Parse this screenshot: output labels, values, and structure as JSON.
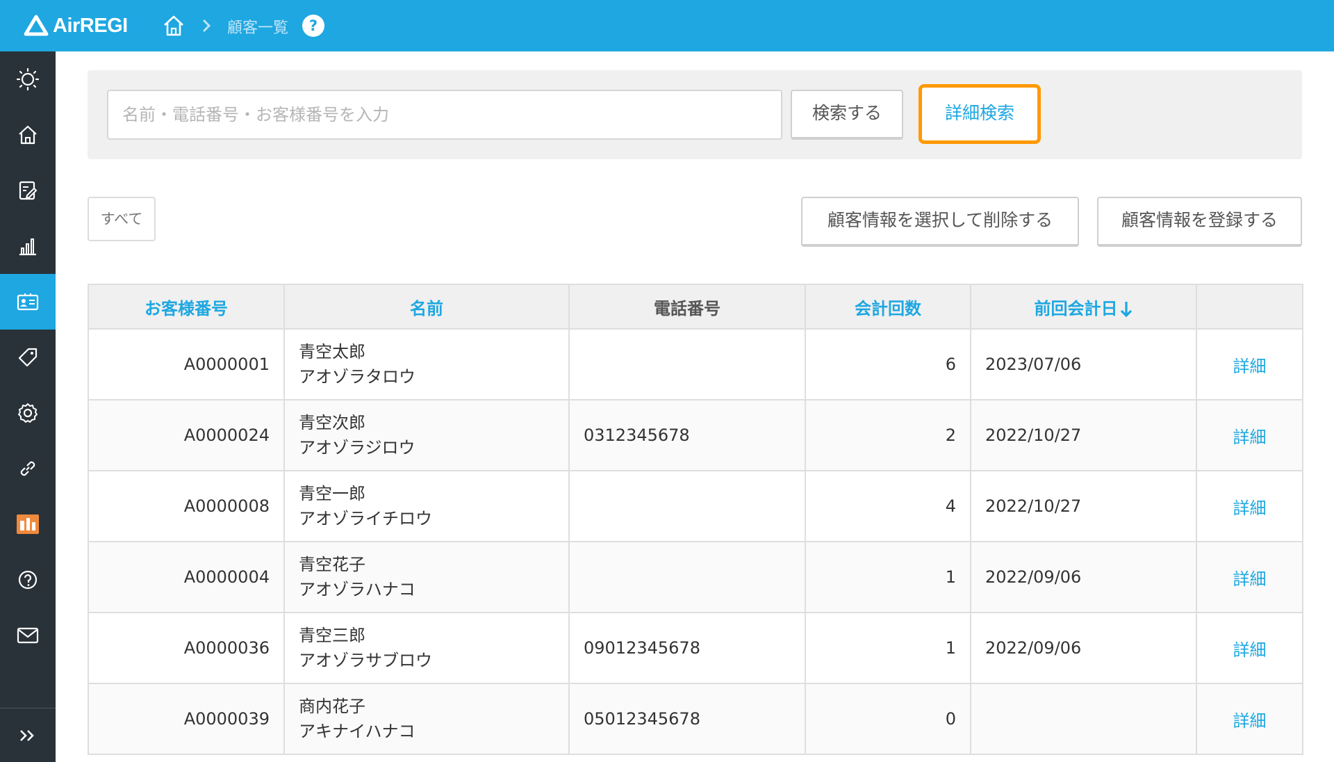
{
  "header": {
    "logo_text": "AirREGI",
    "page_title": "顧客一覧",
    "help_mark": "?"
  },
  "sidebar": {
    "items": [
      {
        "icon": "sun-icon"
      },
      {
        "icon": "home-icon"
      },
      {
        "icon": "edit-note-icon"
      },
      {
        "icon": "bar-chart-icon"
      },
      {
        "icon": "customer-card-icon",
        "active": true
      },
      {
        "icon": "tag-icon"
      },
      {
        "icon": "gear-icon"
      },
      {
        "icon": "link-icon"
      },
      {
        "icon": "store-icon"
      },
      {
        "icon": "help-icon"
      },
      {
        "icon": "mail-icon"
      }
    ],
    "expand_icon": "double-chevron-right-icon"
  },
  "search": {
    "placeholder": "名前・電話番号・お客様番号を入力",
    "value": "",
    "search_label": "検索する",
    "detail_label": "詳細検索"
  },
  "filter": {
    "all_label": "すべて"
  },
  "actions": {
    "delete_label": "顧客情報を選択して削除する",
    "register_label": "顧客情報を登録する"
  },
  "table": {
    "headers": {
      "id": "お客様番号",
      "name": "名前",
      "phone": "電話番号",
      "count": "会計回数",
      "last_date": "前回会計日"
    },
    "rows": [
      {
        "id": "A0000001",
        "name": "青空太郎",
        "kana": "アオゾラタロウ",
        "phone": "",
        "count": "6",
        "last_date": "2023/07/06",
        "link": "詳細"
      },
      {
        "id": "A0000024",
        "name": "青空次郎",
        "kana": "アオゾラジロウ",
        "phone": "0312345678",
        "count": "2",
        "last_date": "2022/10/27",
        "link": "詳細"
      },
      {
        "id": "A0000008",
        "name": "青空一郎",
        "kana": "アオゾライチロウ",
        "phone": "",
        "count": "4",
        "last_date": "2022/10/27",
        "link": "詳細"
      },
      {
        "id": "A0000004",
        "name": "青空花子",
        "kana": "アオゾラハナコ",
        "phone": "",
        "count": "1",
        "last_date": "2022/09/06",
        "link": "詳細"
      },
      {
        "id": "A0000036",
        "name": "青空三郎",
        "kana": "アオゾラサブロウ",
        "phone": "09012345678",
        "count": "1",
        "last_date": "2022/09/06",
        "link": "詳細"
      },
      {
        "id": "A0000039",
        "name": "商内花子",
        "kana": "アキナイハナコ",
        "phone": "05012345678",
        "count": "0",
        "last_date": "",
        "link": "詳細"
      }
    ]
  },
  "colors": {
    "brand": "#1ea7e1",
    "sidebar": "#2a3239",
    "highlight": "#ff9900"
  }
}
